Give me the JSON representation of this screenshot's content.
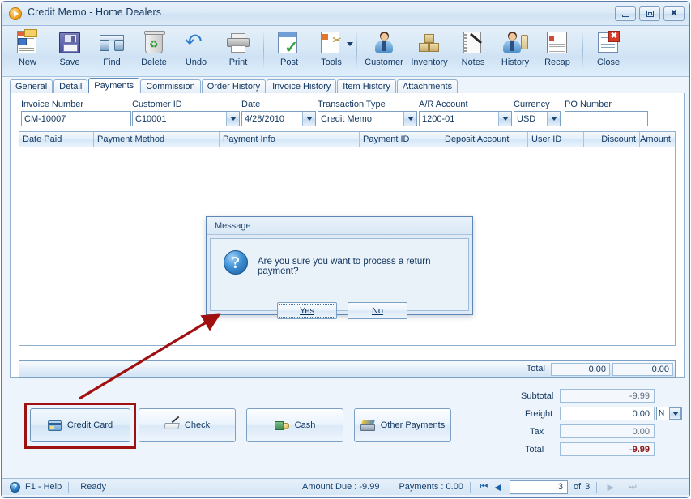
{
  "window": {
    "title": "Credit Memo - Home Dealers",
    "icon": "play-circle-icon",
    "controls": {
      "minimize": "minimize",
      "restore": "restore",
      "close": "close"
    }
  },
  "toolbar": {
    "items": [
      {
        "label": "New",
        "icon": "new-document-icon"
      },
      {
        "label": "Save",
        "icon": "floppy-disk-icon"
      },
      {
        "label": "Find",
        "icon": "binoculars-icon"
      },
      {
        "label": "Delete",
        "icon": "recycle-bin-icon"
      },
      {
        "label": "Undo",
        "icon": "undo-arrow-icon"
      },
      {
        "label": "Print",
        "icon": "printer-icon"
      },
      {
        "label": "Post",
        "icon": "post-checkmark-icon"
      },
      {
        "label": "Tools",
        "icon": "tools-icon",
        "has_dropdown": true
      },
      {
        "label": "Customer",
        "icon": "customer-person-icon"
      },
      {
        "label": "Inventory",
        "icon": "inventory-boxes-icon"
      },
      {
        "label": "Notes",
        "icon": "notepad-pen-icon"
      },
      {
        "label": "History",
        "icon": "history-hourglass-icon"
      },
      {
        "label": "Recap",
        "icon": "recap-report-icon"
      },
      {
        "label": "Close",
        "icon": "close-window-icon"
      }
    ]
  },
  "tabs": {
    "items": [
      "General",
      "Detail",
      "Payments",
      "Commission",
      "Order History",
      "Invoice History",
      "Item History",
      "Attachments"
    ],
    "active": "Payments"
  },
  "form": {
    "fields": [
      {
        "label": "Invoice Number",
        "value": "CM-10007",
        "type": "text"
      },
      {
        "label": "Customer ID",
        "value": "C10001",
        "type": "combo"
      },
      {
        "label": "Date",
        "value": "4/28/2010",
        "type": "combo"
      },
      {
        "label": "Transaction Type",
        "value": "Credit Memo",
        "type": "combo"
      },
      {
        "label": "A/R Account",
        "value": "1200-01",
        "type": "combo"
      },
      {
        "label": "Currency",
        "value": "USD",
        "type": "combo"
      },
      {
        "label": "PO Number",
        "value": "",
        "type": "text"
      }
    ]
  },
  "grid": {
    "columns": [
      "Date Paid",
      "Payment Method",
      "Payment Info",
      "Payment ID",
      "Deposit Account",
      "User ID",
      "Discount",
      "Amount"
    ],
    "rows": [],
    "footer": {
      "label": "Total",
      "discount_total": "0.00",
      "amount_total": "0.00"
    }
  },
  "payment_buttons": [
    {
      "label": "Credit Card",
      "icon": "credit-card-icon",
      "highlighted": true
    },
    {
      "label": "Check",
      "icon": "check-icon",
      "highlighted": false
    },
    {
      "label": "Cash",
      "icon": "cash-icon",
      "highlighted": false
    },
    {
      "label": "Other Payments",
      "icon": "other-payments-icon",
      "highlighted": false
    }
  ],
  "totals": {
    "subtotal_label": "Subtotal",
    "subtotal_value": "-9.99",
    "freight_label": "Freight",
    "freight_value": "0.00",
    "freight_mode": "N",
    "tax_label": "Tax",
    "tax_value": "0.00",
    "total_label": "Total",
    "total_value": "-9.99",
    "total_color": "#8c1616"
  },
  "dialog": {
    "title": "Message",
    "icon": "question-mark-icon",
    "message": "Are you sure you want to process a return payment?",
    "buttons": [
      {
        "label": "Yes",
        "accesskey": "Y",
        "focused": true
      },
      {
        "label": "No",
        "accesskey": "N",
        "focused": false
      }
    ]
  },
  "statusbar": {
    "help_icon": "help-question-icon",
    "help_text": "F1 - Help",
    "state": "Ready",
    "amount_due": "Amount Due : -9.99",
    "payments": "Payments : 0.00",
    "nav": {
      "first": "first-record",
      "prev": "previous-record",
      "current": "3",
      "of_label": "of",
      "total": "3",
      "next": "next-record",
      "last": "last-record"
    }
  },
  "annotation": {
    "arrow_color": "#a01010",
    "highlight_color": "#9e1111",
    "points_from": "credit-card-button",
    "points_to": "message-dialog"
  }
}
